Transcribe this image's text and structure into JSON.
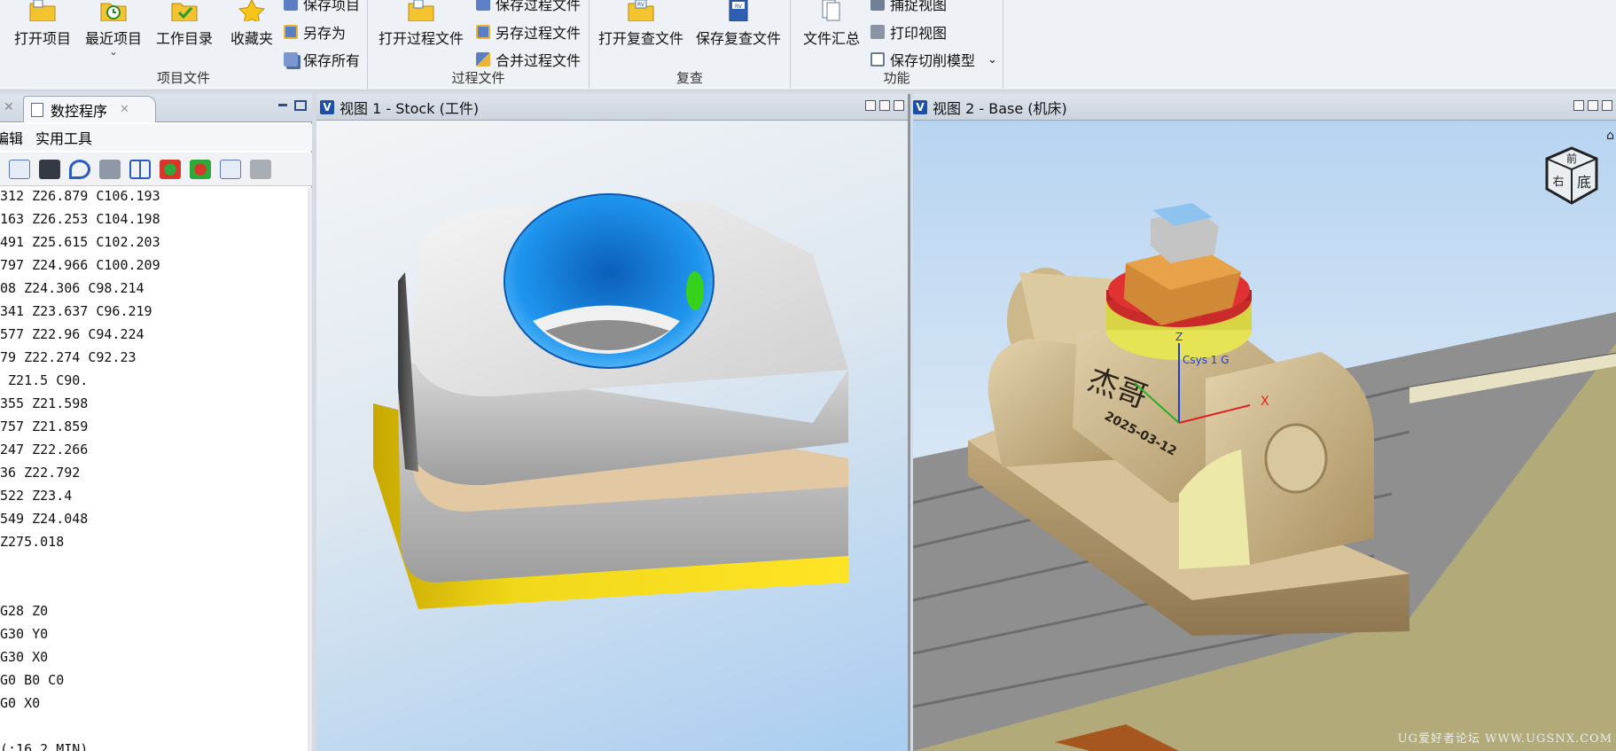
{
  "ribbon": {
    "groups": [
      {
        "label": "项目文件"
      },
      {
        "label": "过程文件"
      },
      {
        "label": "复查"
      },
      {
        "label": "功能"
      }
    ],
    "project": {
      "open": "打开项目",
      "recent": "最近项目",
      "workdir": "工作目录",
      "favorites": "收藏夹",
      "save": "保存项目",
      "save_as": "另存为",
      "save_all": "保存所有"
    },
    "process": {
      "open": "打开过程文件",
      "save": "保存过程文件",
      "save_as": "另存过程文件",
      "merge": "合并过程文件"
    },
    "review": {
      "open": "打开复查文件",
      "save": "保存复查文件",
      "open_icon_text": "RV",
      "save_icon_text": "RV"
    },
    "functions": {
      "summary": "文件汇总",
      "capture": "捕捉视图",
      "print": "打印视图",
      "save_cut": "保存切削模型"
    }
  },
  "left_panel": {
    "tab_title": "数控程序",
    "menu": [
      "编辑",
      "实用工具"
    ],
    "code_lines": [
      "312 Z26.879 C106.193",
      "163 Z26.253 C104.198",
      "491 Z25.615 C102.203",
      "797 Z24.966 C100.209",
      "08 Z24.306 C98.214",
      "341 Z23.637 C96.219",
      "577 Z22.96 C94.224",
      "79 Z22.274 C92.23",
      " Z21.5 C90.",
      "355 Z21.598",
      "757 Z21.859",
      "247 Z22.266",
      "36 Z22.792",
      "522 Z23.4",
      "549 Z24.048",
      "Z275.018",
      "",
      "",
      "G28 Z0",
      "G30 Y0",
      "G30 X0",
      "G0 B0 C0",
      "G0 X0",
      "",
      "(:16.2 MIN)"
    ]
  },
  "viewport1": {
    "title": "视图 1 - Stock (工件)"
  },
  "viewport2": {
    "title": "视图 2 - Base (机床)",
    "engraving_name": "杰哥",
    "engraving_date": "2025-03-12",
    "axis_x": "X",
    "axis_z": "Z",
    "csys_label": "Csys 1 G",
    "cube_top": "前",
    "cube_left": "右",
    "cube_front": "底"
  },
  "watermark": "UG爱好者论坛 WWW.UGSNX.COM",
  "colors": {
    "ribbon_bg": "#eef1f5",
    "stock_gray": "#c9c9c9",
    "pocket_blue": "#1f8fe6",
    "base_yellow": "#f0d81a",
    "fixture_tan": "#cdb88c",
    "table_gray": "#8c8c8c",
    "floor_olive": "#b1a877"
  }
}
